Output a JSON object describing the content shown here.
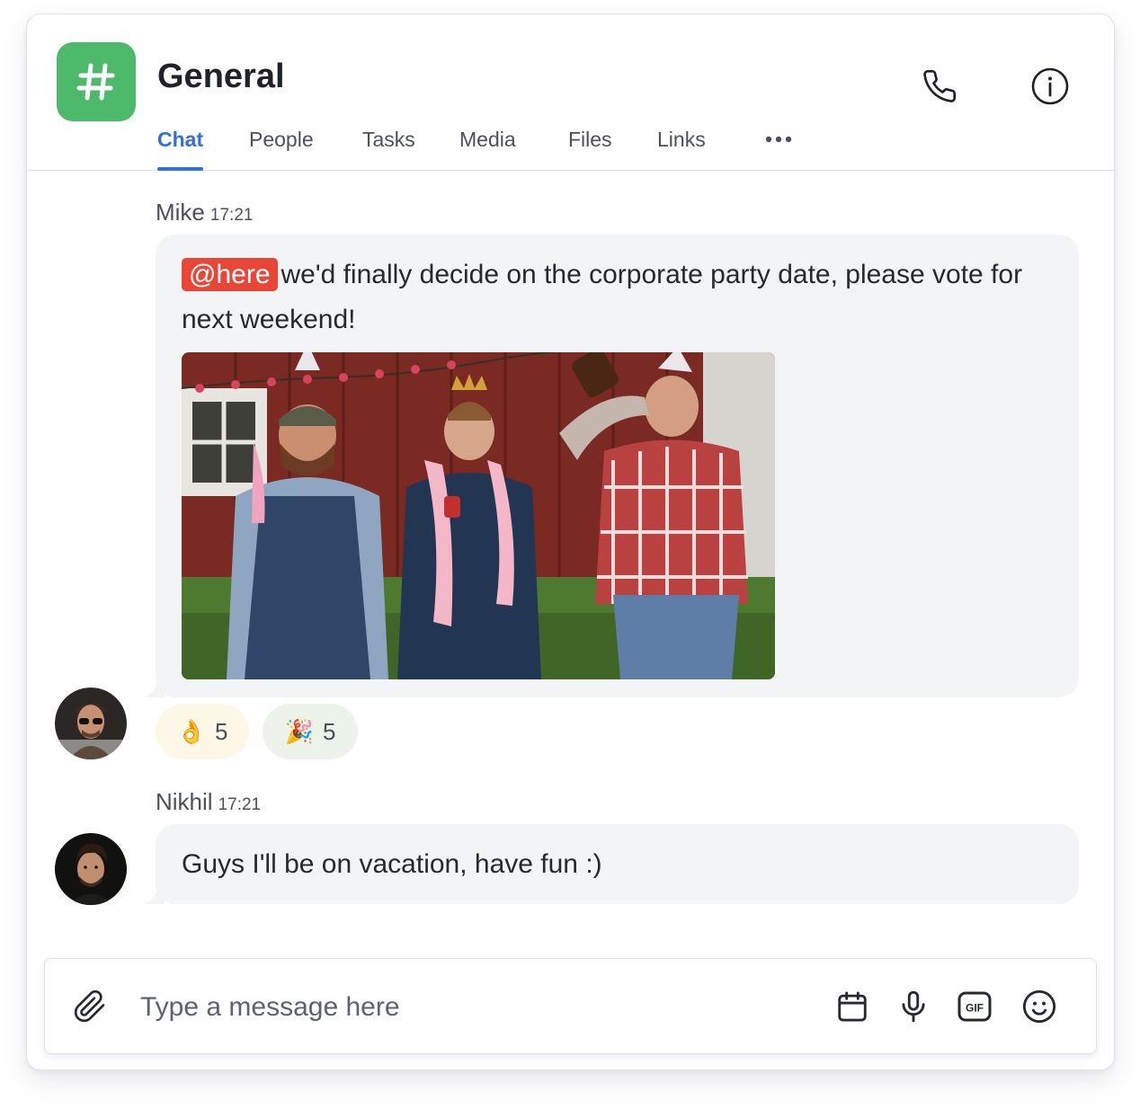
{
  "colors": {
    "accent": "#2f6fe0",
    "channel_icon": "#4cba6a",
    "mention_bg": "#ea4637",
    "reaction_ok_bg": "#fdf7e8",
    "reaction_party_bg": "#ebf3ea"
  },
  "channel": {
    "icon_glyph": "#",
    "title": "General"
  },
  "header": {
    "call_icon": "phone-icon",
    "info_icon": "info-icon"
  },
  "tabs": [
    {
      "label": "Chat",
      "active": true
    },
    {
      "label": "People"
    },
    {
      "label": "Tasks"
    },
    {
      "label": "Media"
    },
    {
      "label": "Files"
    },
    {
      "label": "Links"
    }
  ],
  "tabs_more_icon": "more-horizontal-icon",
  "messages": [
    {
      "author": "Mike",
      "time": "17:21",
      "mention": "@here",
      "text_line1": "we'd finally decide on the corporate party date, please vote for",
      "text_line2": "next weekend!",
      "attachment": "party-gif",
      "reactions": [
        {
          "emoji": "👌",
          "count": "5"
        },
        {
          "emoji": "🎉",
          "count": "5"
        }
      ]
    },
    {
      "author": "Nikhil",
      "time": "17:21",
      "text": "Guys I'll be on vacation, have fun :)"
    }
  ],
  "composer": {
    "placeholder": "Type a message here",
    "value": "",
    "icons": [
      "paperclip-icon",
      "calendar-icon",
      "microphone-icon",
      "gif-icon",
      "smiley-icon"
    ],
    "gif_label": "GIF"
  }
}
